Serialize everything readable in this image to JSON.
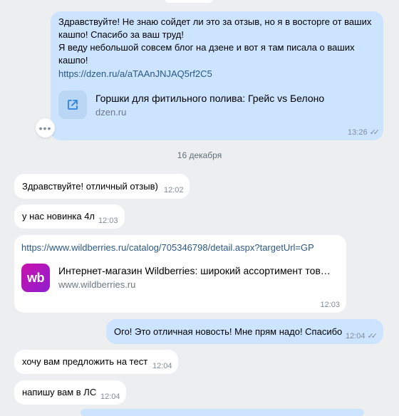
{
  "messages": {
    "m1": {
      "text": "Здравствуйте! Не знаю сойдет ли это за отзыв, но я в восторге от ваших\nкашпо! Спасибо за ваш труд!\nЯ веду небольшой совсем блог на дзене и вот я там писала о ваших\nкашпо!",
      "link": "https://dzen.ru/a/aTAAnJNJAQ5rf2C5",
      "card_title": "Горшки для фитильного полива: Грейс vs Белоно",
      "card_domain": "dzen.ru",
      "time": "13:26"
    },
    "date_separator": "16 декабря",
    "m2": {
      "text": "Здравствуйте! отличный отзыв)",
      "time": "12:02"
    },
    "m3": {
      "text": "у нас новинка 4л",
      "time": "12:03"
    },
    "m4": {
      "link": "https://www.wildberries.ru/catalog/705346798/detail.aspx?targetUrl=GP",
      "card_logo": "wb",
      "card_title": "Интернет-магазин Wildberries: широкий ассортимент това…",
      "card_domain": "www.wildberries.ru",
      "time": "12:03"
    },
    "m5": {
      "text": "Ого! Это отличная новость! Мне прям надо! Спасибо",
      "time": "12:04"
    },
    "m6": {
      "text": "хочу вам предложить на тест",
      "time": "12:04"
    },
    "m7": {
      "text": "напишу вам в ЛС",
      "time": "12:04"
    }
  },
  "icons": {
    "external_link": "external-link-icon",
    "more": "more-horizontal-icon",
    "read": "double-check-icon",
    "wb_logo": "wildberries-logo"
  },
  "colors": {
    "background": "#edeef0",
    "outgoing_bubble": "#cce4ff",
    "incoming_bubble": "#ffffff",
    "link": "#2a5885",
    "wb_brand": "#a11ac8"
  }
}
